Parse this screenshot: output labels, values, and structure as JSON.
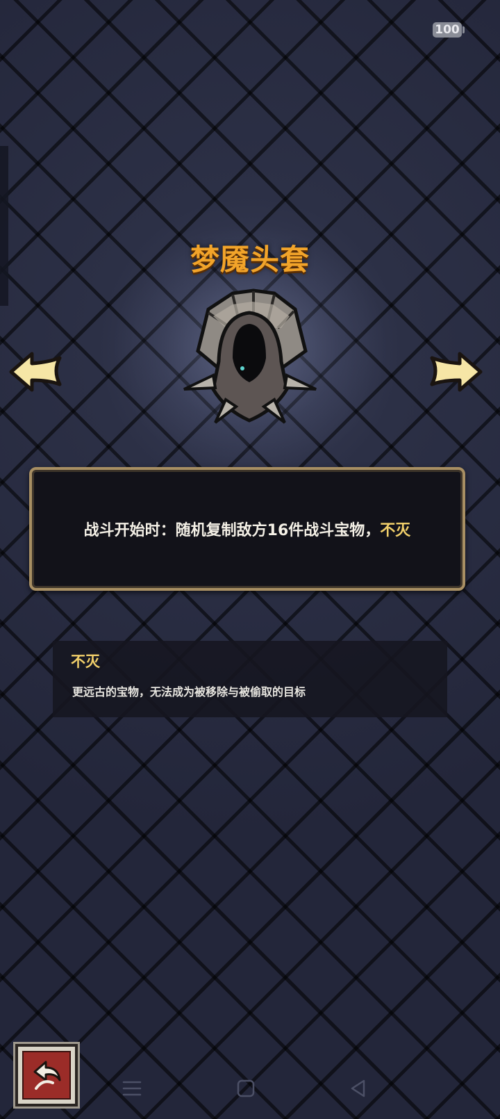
{
  "status_bar": {
    "battery_level": "100"
  },
  "item": {
    "name": "梦魇头套",
    "icon": "nightmare-hood-icon",
    "description_main": "战斗开始时：随机复制敌方16件战斗宝物，",
    "description_keyword": "不灭"
  },
  "keyword": {
    "title": "不灭",
    "description": "更远古的宝物，无法成为被移除与被偷取的目标"
  },
  "navigation": {
    "prev_icon": "left-arrow-icon",
    "next_icon": "right-arrow-icon",
    "back_icon": "return-arrow-icon"
  },
  "system_nav": {
    "menu_icon": "menu-icon",
    "home_icon": "home-icon",
    "back_icon": "back-triangle-icon"
  },
  "colors": {
    "title": "#f2a42a",
    "keyword": "#f1cf6a",
    "panel_border": "#a88f63",
    "back_button": "#9b2c28"
  }
}
